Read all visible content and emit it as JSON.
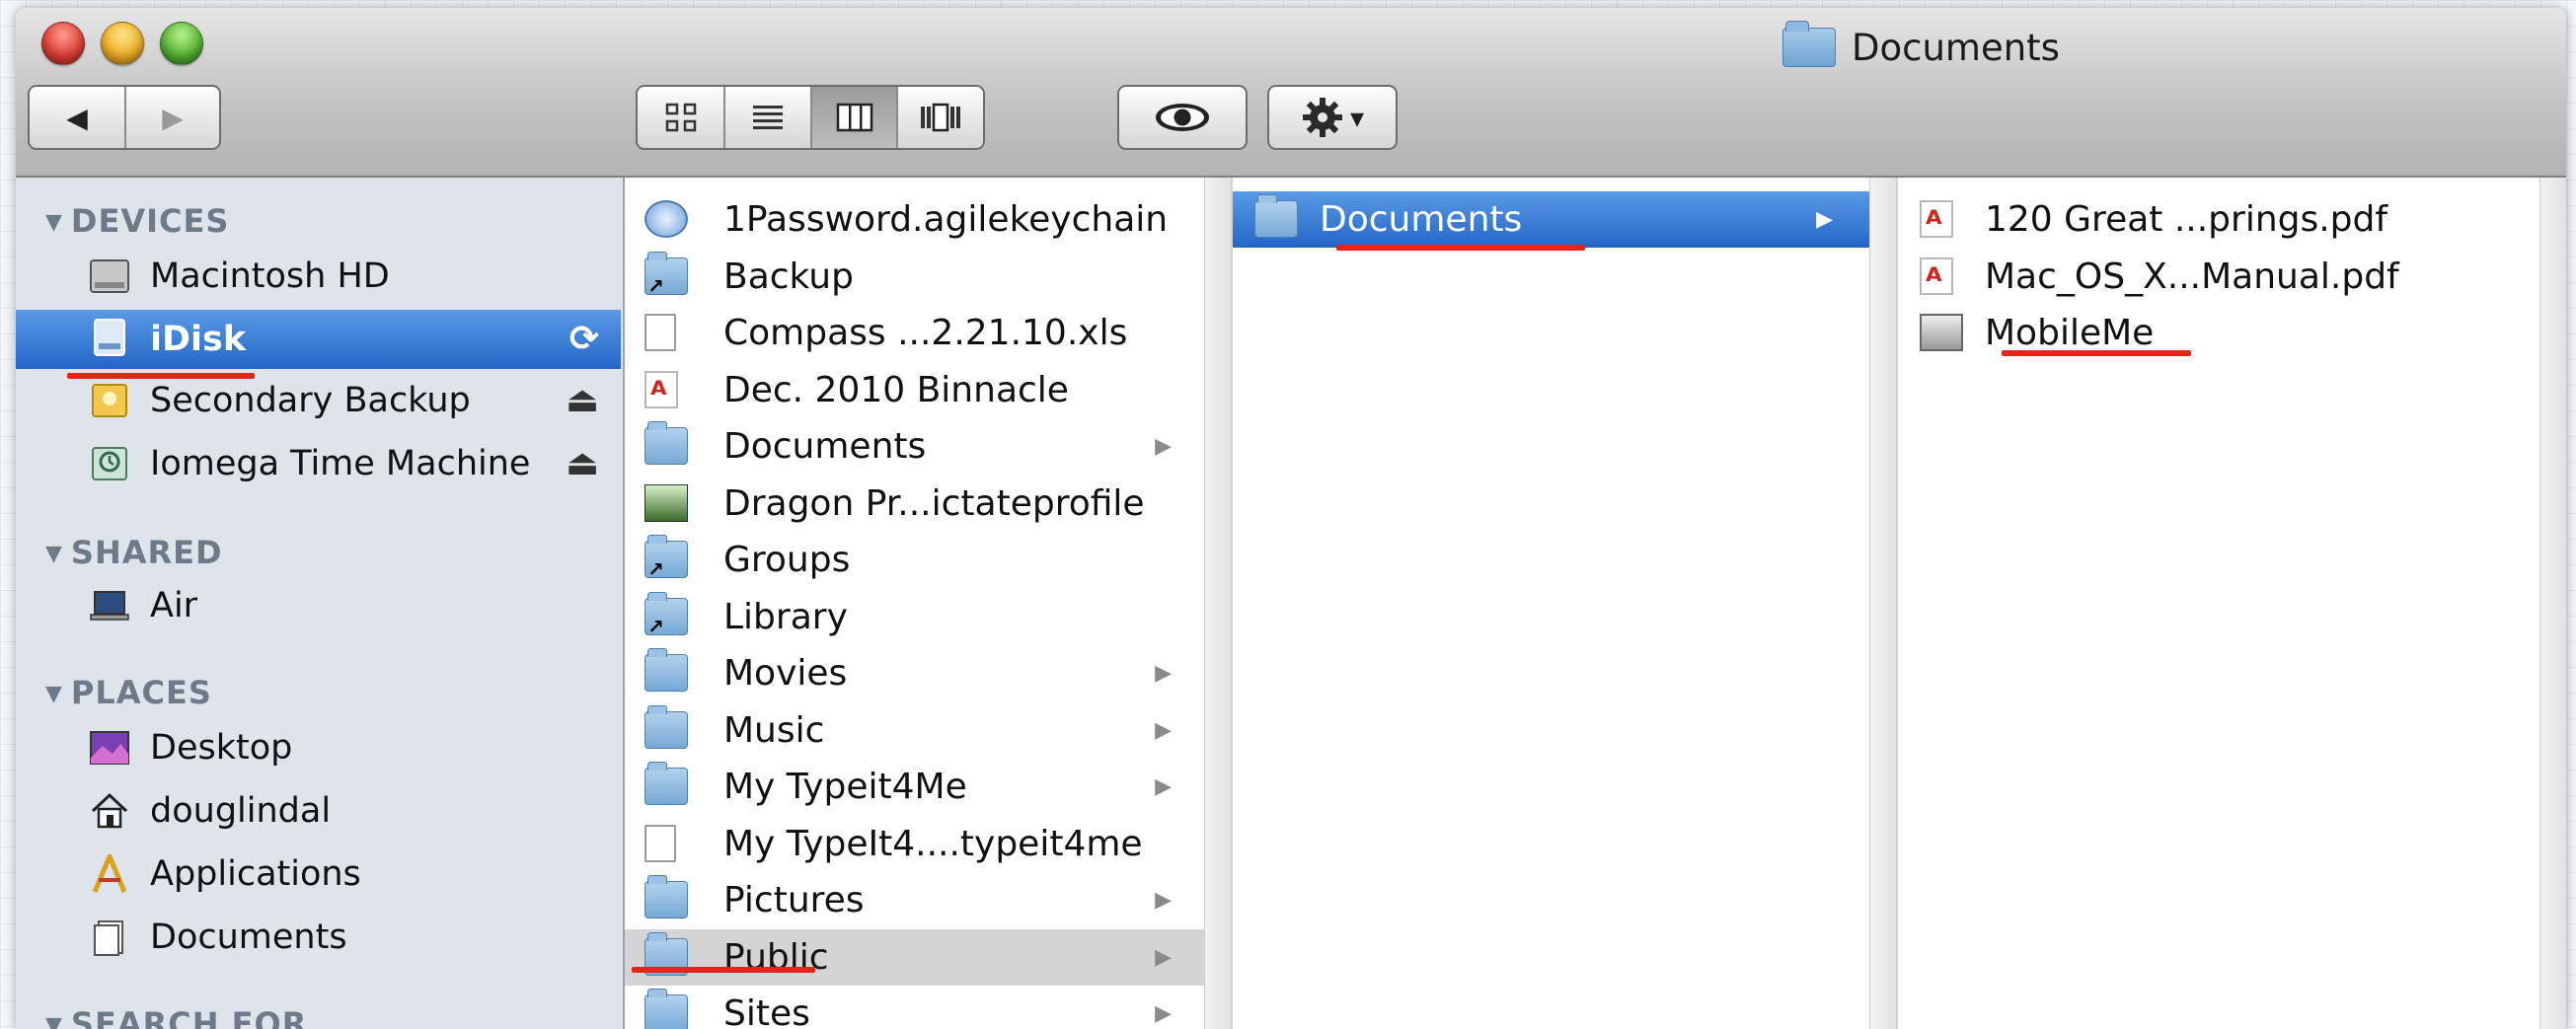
{
  "window": {
    "title": "Documents"
  },
  "toolbar": {
    "back_icon": "◀",
    "forward_icon": "▶",
    "view_icons": [
      "icon-view-icon",
      "list-view-icon",
      "column-view-icon",
      "coverflow-view-icon"
    ],
    "quicklook_icon": "eye-icon",
    "action_icon": "gear-icon",
    "action_caret": "▾"
  },
  "sidebar": {
    "sections": [
      {
        "header": "DEVICES",
        "items": [
          {
            "label": "Macintosh HD",
            "icon": "hard-drive-icon"
          },
          {
            "label": "iDisk",
            "icon": "idisk-icon",
            "selected": true,
            "right": "⟳"
          },
          {
            "label": "Secondary Backup",
            "icon": "external-drive-icon",
            "right": "⏏"
          },
          {
            "label": "Iomega Time Machine",
            "icon": "time-machine-drive-icon",
            "right": "⏏"
          }
        ]
      },
      {
        "header": "SHARED",
        "items": [
          {
            "label": "Air",
            "icon": "laptop-icon"
          }
        ]
      },
      {
        "header": "PLACES",
        "items": [
          {
            "label": "Desktop",
            "icon": "desktop-icon"
          },
          {
            "label": "douglindal",
            "icon": "home-icon"
          },
          {
            "label": "Applications",
            "icon": "applications-icon"
          },
          {
            "label": "Documents",
            "icon": "documents-icon"
          }
        ]
      },
      {
        "header": "SEARCH FOR",
        "items": []
      }
    ]
  },
  "columns": {
    "col1": [
      {
        "label": "1Password.agilekeychain",
        "icon": "keychain-icon",
        "kind": "round"
      },
      {
        "label": "Backup",
        "icon": "alias-folder-icon",
        "kind": "alias"
      },
      {
        "label": "Compass ...2.21.10.xls",
        "icon": "spreadsheet-icon",
        "kind": "doc"
      },
      {
        "label": "Dec. 2010 Binnacle",
        "icon": "pdf-icon",
        "kind": "pdf"
      },
      {
        "label": "Documents",
        "icon": "folder-icon",
        "kind": "folder",
        "arrow": true
      },
      {
        "label": "Dragon Pr...ictateprofile",
        "icon": "dragon-profile-icon",
        "kind": "green"
      },
      {
        "label": "Groups",
        "icon": "alias-folder-icon",
        "kind": "alias"
      },
      {
        "label": "Library",
        "icon": "alias-folder-icon",
        "kind": "alias"
      },
      {
        "label": "Movies",
        "icon": "folder-icon",
        "kind": "folder",
        "arrow": true
      },
      {
        "label": "Music",
        "icon": "folder-icon",
        "kind": "folder",
        "arrow": true
      },
      {
        "label": "My Typeit4Me",
        "icon": "folder-icon",
        "kind": "folder",
        "arrow": true
      },
      {
        "label": "My TypeIt4....typeit4me",
        "icon": "typeit4me-file-icon",
        "kind": "doc"
      },
      {
        "label": "Pictures",
        "icon": "folder-icon",
        "kind": "folder",
        "arrow": true
      },
      {
        "label": "Public",
        "icon": "folder-icon",
        "kind": "folder",
        "arrow": true,
        "selected": "gray"
      },
      {
        "label": "Sites",
        "icon": "folder-icon",
        "kind": "folder",
        "arrow": true
      }
    ],
    "col2": [
      {
        "label": "Documents",
        "icon": "folder-icon",
        "kind": "folder",
        "arrow": true,
        "selected": "blue"
      }
    ],
    "col3": [
      {
        "label": "120 Great ...prings.pdf",
        "icon": "pdf-icon",
        "kind": "pdf"
      },
      {
        "label": "Mac_OS_X...Manual.pdf",
        "icon": "pdf-icon",
        "kind": "pdf"
      },
      {
        "label": "MobileMe",
        "icon": "mobileme-image-icon",
        "kind": "img"
      }
    ]
  },
  "colors": {
    "selection_blue": "#2466c7",
    "sidebar_bg": "#dee4ea",
    "annotation_red": "#e3251b"
  }
}
